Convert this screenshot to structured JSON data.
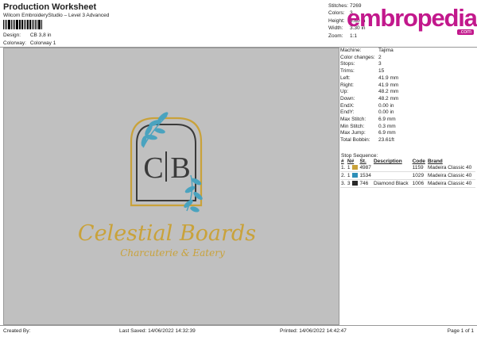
{
  "header": {
    "title": "Production Worksheet",
    "subtitle": "Wilcom EmbroideryStudio – Level 3 Advanced",
    "design_label": "Design:",
    "design_value": "CB 3,8 in",
    "colorway_label": "Colorway:",
    "colorway_value": "Colorway 1"
  },
  "stats": [
    {
      "k": "Stitches:",
      "v": "7269"
    },
    {
      "k": "Colors:",
      "v": "3"
    },
    {
      "k": "Height:",
      "v": "3.80 in"
    },
    {
      "k": "Width:",
      "v": "3.30 in"
    },
    {
      "k": "Zoom:",
      "v": "1:1"
    }
  ],
  "logo": {
    "text": "embropedia",
    "suffix": ".com",
    "color": "#c2188c"
  },
  "design_art": {
    "monogram_left": "C",
    "monogram_right": "B",
    "brand": "Celestial Boards",
    "tagline": "Charcuterie & Eatery"
  },
  "machine_info": [
    {
      "k": "Machine:",
      "v": "Tajima"
    },
    {
      "k": "Color changes:",
      "v": "2"
    },
    {
      "k": "Stops:",
      "v": "3"
    },
    {
      "k": "Trims:",
      "v": "15"
    },
    {
      "k": "Left:",
      "v": "41.9 mm"
    },
    {
      "k": "Right:",
      "v": "41.9 mm"
    },
    {
      "k": "Up:",
      "v": "48.2 mm"
    },
    {
      "k": "Down:",
      "v": "48.2 mm"
    },
    {
      "k": "EndX:",
      "v": "0.00 in"
    },
    {
      "k": "EndY:",
      "v": "0.00 in"
    },
    {
      "k": "Max Stitch:",
      "v": "6.9 mm"
    },
    {
      "k": "Min Stitch:",
      "v": "0.3 mm"
    },
    {
      "k": "Max Jump:",
      "v": "6.9 mm"
    },
    {
      "k": "Total Bobbin:",
      "v": "23.61ft"
    }
  ],
  "stop_sequence": {
    "label": "Stop Sequence:",
    "headers": [
      "#",
      "N#",
      "St.",
      "Description",
      "Code",
      "Brand"
    ],
    "rows": [
      {
        "num": "1.",
        "n": "1",
        "color": "#c9a23a",
        "st": "4987",
        "desc": "",
        "code": "1159",
        "brand": "Madeira Classic 40"
      },
      {
        "num": "2.",
        "n": "1",
        "color": "#2e8fb8",
        "st": "1534",
        "desc": "",
        "code": "1029",
        "brand": "Madeira Classic 40"
      },
      {
        "num": "3.",
        "n": "3",
        "color": "#2a2a2a",
        "st": "746",
        "desc": "Diamond Black",
        "code": "1006",
        "brand": "Madeira Classic 40"
      }
    ]
  },
  "footer": {
    "created": "Created By:",
    "saved": "Last Saved: 14/06/2022 14:32:39",
    "printed": "Printed: 14/06/2022 14:42:47",
    "page": "Page 1 of 1"
  },
  "colors": {
    "gold": "#c9a23a",
    "teal": "#4aa3bf",
    "charcoal": "#3a3a3a",
    "panel": "#c0c0c0"
  }
}
